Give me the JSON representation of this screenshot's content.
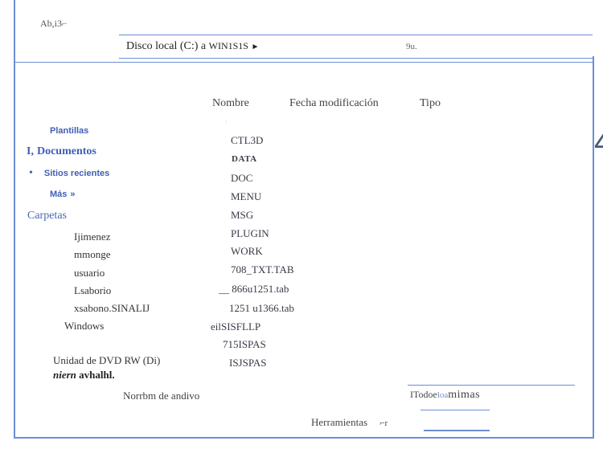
{
  "window": {
    "title": "Ab,i3⌐"
  },
  "address_bar": {
    "location": "Disco local (C:)",
    "separator": "a",
    "folder": "WIN1S1S",
    "arrow": "►",
    "search_text": "9u."
  },
  "columns": {
    "name": "Nombre",
    "date_modified": "Fecha modificación",
    "type": "Tipo"
  },
  "nav": {
    "favorites": [
      {
        "label": "Plantillas"
      },
      {
        "prefix": "I,",
        "label": "Documentos"
      },
      {
        "label": "Sitios recientes"
      },
      {
        "label": "Más",
        "suffix": "»"
      }
    ],
    "folders_header": "Carpetas",
    "tree": [
      "Ijimenez",
      "mmonge",
      "usuario",
      "Lsaborio",
      "xsabono.SINALIJ",
      "Windows"
    ],
    "drive": "Unidad de DVD RW (Di)",
    "drive_sub": {
      "italic": "niern",
      "rest": "avhalhl."
    }
  },
  "files": {
    "tick": ":",
    "items": [
      "CTL3D",
      "DATA",
      "DOC",
      "MENU",
      "MSG",
      "PLUGIN",
      "WORK",
      "708_TXT.TAB",
      "__ 866u1251.tab",
      "1251 u1366.tab",
      "eilSISFLLP",
      "715ISPAS",
      "ISJSPAS"
    ]
  },
  "partial_glyph": "4",
  "bottom": {
    "filename_label": "Norrbm de andivo",
    "filetype": {
      "part1": "ITodoe",
      "part2": "loa",
      "part3": "mimas"
    },
    "tools_label": "Herramientas",
    "tools_arrow": "⌐r"
  },
  "colors": {
    "accent": "#6c8ed4",
    "nav_link": "#3f5fb5"
  }
}
